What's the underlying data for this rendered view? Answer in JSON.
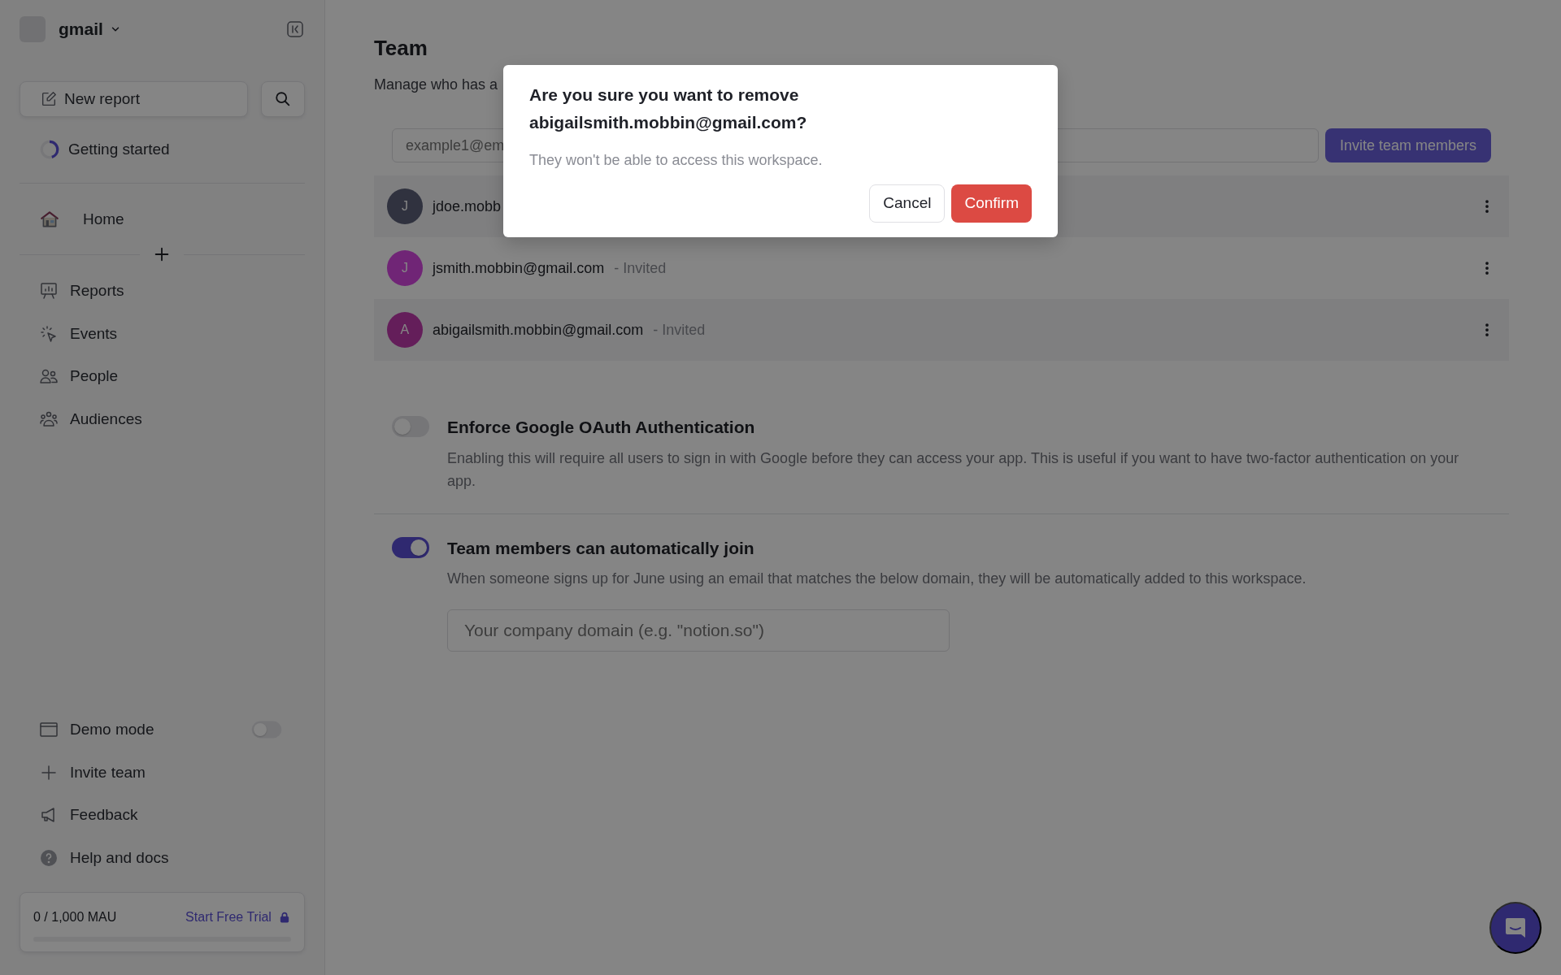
{
  "workspace": {
    "name": "gmail"
  },
  "sidebar": {
    "new_report": "New report",
    "getting_started": {
      "label": "Getting started",
      "level": 0.45
    },
    "home": "Home",
    "nav": [
      {
        "label": "Reports",
        "kind": "reports"
      },
      {
        "label": "Events",
        "kind": "events"
      },
      {
        "label": "People",
        "kind": "people"
      },
      {
        "label": "Audiences",
        "kind": "audiences"
      }
    ],
    "bottom": [
      {
        "label": "Demo mode",
        "kind": "demo",
        "on": false
      },
      {
        "label": "Invite team",
        "kind": "invite"
      },
      {
        "label": "Feedback",
        "kind": "feedback"
      },
      {
        "label": "Help and docs",
        "kind": "help"
      }
    ],
    "usage": {
      "reading": "0 / 1,000 MAU",
      "link": "Start Free Trial",
      "level": 0
    }
  },
  "page": {
    "title": "Team",
    "subtitle": "Manage who has a",
    "invite": {
      "placeholder": "example1@em",
      "button": "Invite team members",
      "disabled": true
    },
    "members": [
      {
        "initial": "J",
        "email": "jdoe.mobb",
        "color": "#30323f"
      },
      {
        "initial": "J",
        "email": "jsmith.mobbin@gmail.com",
        "status": "- Invited",
        "color": "#702576"
      },
      {
        "initial": "A",
        "email": "abigailsmith.mobbin@gmail.com",
        "status": "- Invited",
        "color": "#641e5a"
      }
    ],
    "settings": [
      {
        "title": "Enforce Google OAuth Authentication",
        "description": "Enabling this will require all users to sign in with Google before they can access your app. This is useful if you want to have two-factor authentication on your app.",
        "on": false
      },
      {
        "title": "Team members can automatically join",
        "description": "When someone signs up for June using an email that matches the below domain, they will be automatically added to this workspace.",
        "on": true,
        "placeholder": "Your company domain (e.g. \"notion.so\")"
      }
    ]
  },
  "dialog": {
    "title": "Are you sure you want to remove abigailsmith.mobbin@gmail.com?",
    "message": "They won't be able to access this workspace.",
    "cancel": "Cancel",
    "confirm": "Confirm"
  }
}
